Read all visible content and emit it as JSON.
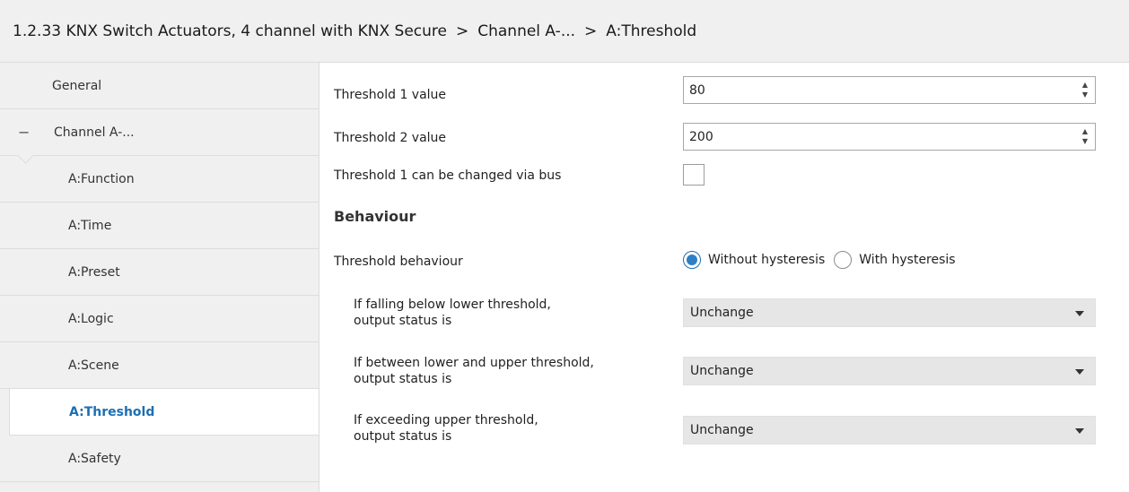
{
  "breadcrumb": {
    "device": "1.2.33 KNX Switch Actuators, 4 channel with KNX Secure",
    "sep1": ">",
    "channel": "Channel A-...",
    "sep2": ">",
    "page": "A:Threshold"
  },
  "sidebar": {
    "general": "General",
    "channel": "Channel A-...",
    "channel_toggle": "−",
    "items": [
      "A:Function",
      "A:Time",
      "A:Preset",
      "A:Logic",
      "A:Scene",
      "A:Threshold",
      "A:Safety"
    ],
    "active": "A:Threshold"
  },
  "params": {
    "threshold1": {
      "label": "Threshold 1 value",
      "value": "80"
    },
    "threshold2": {
      "label": "Threshold 2 value",
      "value": "200"
    },
    "changeable": {
      "label": "Threshold 1 can be changed via bus",
      "checked": false
    },
    "behaviour_heading": "Behaviour",
    "behaviour": {
      "label": "Threshold behaviour",
      "options": [
        "Without hysteresis",
        "With hysteresis"
      ],
      "selected": "Without hysteresis"
    },
    "below": {
      "label1": "If falling below lower threshold,",
      "label2": "output status is",
      "value": "Unchange"
    },
    "between": {
      "label1": "If between lower and upper threshold,",
      "label2": "output status is",
      "value": "Unchange"
    },
    "exceeding": {
      "label1": "If exceeding upper threshold,",
      "label2": "output status is",
      "value": "Unchange"
    }
  },
  "colors": {
    "accent": "#1b6fb3",
    "sidebar_bg": "#f0f0f0",
    "select_bg": "#e6e6e6"
  },
  "icons": {
    "spin": "spinner-arrows-icon",
    "dropdown": "chevron-down-icon",
    "collapse": "minus-icon"
  }
}
